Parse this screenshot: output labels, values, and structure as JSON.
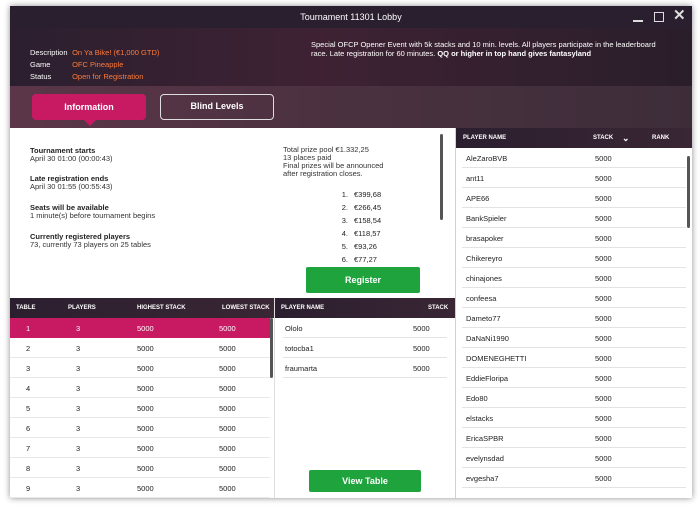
{
  "window": {
    "title": "Tournament 11301 Lobby"
  },
  "header": {
    "rows": [
      {
        "key": "Description",
        "value": "On Ya Bike! (€1,000 GTD)"
      },
      {
        "key": "Game",
        "value": "OFC Pineapple"
      },
      {
        "key": "Status",
        "value": "Open for Registration"
      }
    ],
    "desc_normal": "Special OFCP Opener Event with 5k stacks and 10 min. levels. All players participate in the leaderboard race. Late registration for 60 minutes. ",
    "desc_bold": "QQ or higher in top hand gives fantasyland"
  },
  "tabs": {
    "information": "Information",
    "blind_levels": "Blind Levels"
  },
  "info": {
    "starts_label": "Tournament starts",
    "starts_value": "April 30  01:00 (00:00:43)",
    "late_label": "Late registration ends",
    "late_value": "April 30  01:55 (00:55:43)",
    "seats_label": "Seats will be available",
    "seats_value": "1 minute(s) before tournament begins",
    "registered_label": "Currently registered players",
    "registered_value": "73, currently 73 players on 25 tables",
    "prize_pool": "Total prize pool €1.332,25",
    "places_paid": "13 places paid",
    "final_prizes_1": "Final prizes will be announced",
    "final_prizes_2": "after registration closes.",
    "prizes": [
      {
        "n": "1.",
        "amount": "€399,68"
      },
      {
        "n": "2.",
        "amount": "€266,45"
      },
      {
        "n": "3.",
        "amount": "€158,54"
      },
      {
        "n": "4.",
        "amount": "€118,57"
      },
      {
        "n": "5.",
        "amount": "€93,26"
      },
      {
        "n": "6.",
        "amount": "€77,27"
      }
    ],
    "register_label": "Register"
  },
  "tables": {
    "headers": {
      "table": "TABLE",
      "players": "PLAYERS",
      "highest": "HIGHEST STACK",
      "lowest": "LOWEST STACK"
    },
    "rows": [
      {
        "table": "1",
        "players": "3",
        "highest": "5000",
        "lowest": "5000"
      },
      {
        "table": "2",
        "players": "3",
        "highest": "5000",
        "lowest": "5000"
      },
      {
        "table": "3",
        "players": "3",
        "highest": "5000",
        "lowest": "5000"
      },
      {
        "table": "4",
        "players": "3",
        "highest": "5000",
        "lowest": "5000"
      },
      {
        "table": "5",
        "players": "3",
        "highest": "5000",
        "lowest": "5000"
      },
      {
        "table": "6",
        "players": "3",
        "highest": "5000",
        "lowest": "5000"
      },
      {
        "table": "7",
        "players": "3",
        "highest": "5000",
        "lowest": "5000"
      },
      {
        "table": "8",
        "players": "3",
        "highest": "5000",
        "lowest": "5000"
      },
      {
        "table": "9",
        "players": "3",
        "highest": "5000",
        "lowest": "5000"
      }
    ],
    "selected_index": 0
  },
  "table_players": {
    "headers": {
      "name": "PLAYER NAME",
      "stack": "STACK"
    },
    "rows": [
      {
        "name": "Ololo",
        "stack": "5000"
      },
      {
        "name": "totocba1",
        "stack": "5000"
      },
      {
        "name": "fraumarta",
        "stack": "5000"
      }
    ],
    "view_table_label": "View Table"
  },
  "players": {
    "headers": {
      "name": "PLAYER NAME",
      "stack": "STACK",
      "rank": "RANK"
    },
    "rows": [
      {
        "name": "AleZaroBVB",
        "stack": "5000"
      },
      {
        "name": "ant11",
        "stack": "5000"
      },
      {
        "name": "APE66",
        "stack": "5000"
      },
      {
        "name": "BankSpieler",
        "stack": "5000"
      },
      {
        "name": "brasapoker",
        "stack": "5000"
      },
      {
        "name": "Chikereyro",
        "stack": "5000"
      },
      {
        "name": "chinajones",
        "stack": "5000"
      },
      {
        "name": "confeesa",
        "stack": "5000"
      },
      {
        "name": "Dameto77",
        "stack": "5000"
      },
      {
        "name": "DaNaNi1990",
        "stack": "5000"
      },
      {
        "name": "DOMENEGHETTI",
        "stack": "5000"
      },
      {
        "name": "EddieFloripa",
        "stack": "5000"
      },
      {
        "name": "Edo80",
        "stack": "5000"
      },
      {
        "name": "elstacks",
        "stack": "5000"
      },
      {
        "name": "EricaSPBR",
        "stack": "5000"
      },
      {
        "name": "evelynsdad",
        "stack": "5000"
      },
      {
        "name": "evgesha7",
        "stack": "5000"
      }
    ]
  },
  "colors": {
    "accent": "#c71a63",
    "green": "#1fa33d",
    "status": "#ff7a3a",
    "dark": "#2b1f2f"
  }
}
